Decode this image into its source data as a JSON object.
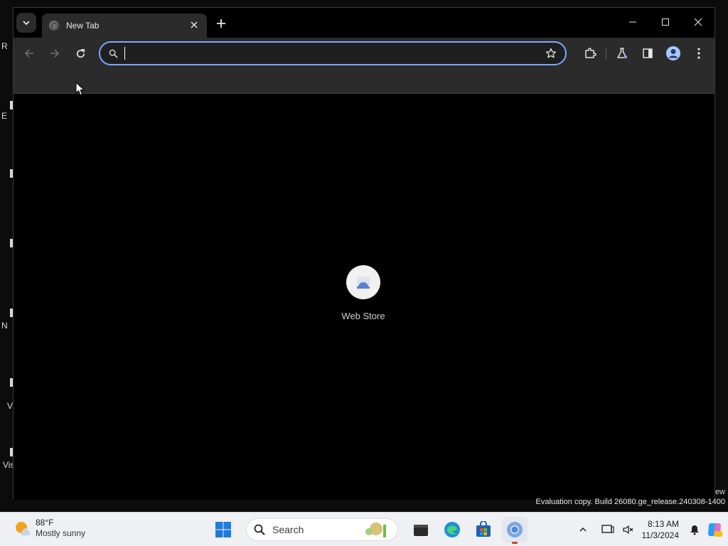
{
  "desktop": {
    "fragments": [
      "R",
      "E",
      "N",
      "V",
      "Vis"
    ],
    "watermark": "Evaluation copy. Build 26080.ge_release.240308-1400",
    "watermark_fragment": "ew"
  },
  "browser": {
    "tab": {
      "title": "New Tab"
    },
    "omnibox": {
      "value": "",
      "placeholder": ""
    },
    "shortcut": {
      "label": "Web Store"
    }
  },
  "taskbar": {
    "weather": {
      "temp": "88°F",
      "condition": "Mostly sunny"
    },
    "search_label": "Search",
    "clock": {
      "time": "8:13 AM",
      "date": "11/3/2024"
    }
  },
  "colors": {
    "omnibox_focus": "#7ca7ff",
    "toolbar": "#2b2b2b",
    "taskbar": "#eef0f4"
  }
}
